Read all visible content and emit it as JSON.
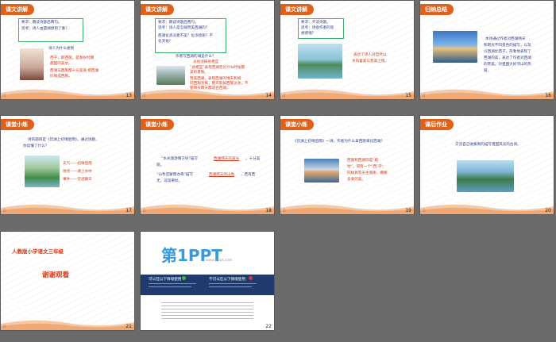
{
  "slides": [
    {
      "num": "13",
      "tag": "课文讲解",
      "lines": [
        "要求：朗读诗歌后两句。",
        "思考：诗人由西湖想到了谁？",
        "诗人为什么想到",
        "西子，即西施，是春秋时期",
        "越国的美女。",
        "西湖与西施都十分美丽 把西湖",
        "比喻成西施。"
      ]
    },
    {
      "num": "14",
      "tag": "课文讲解",
      "lines": [
        "要求：朗读诗歌后两句。",
        "思考：诗人是怎样赞美西湖的？",
        "西湖化浓淡素不美？化浓妆呢？不",
        "化浓妆？",
        "作者写西湖的湖是什么？",
        "淡妆浓抹总相宜",
        "“总相宜”表现西湖无论什么时候都",
        "美的景致。",
        "赞美西湖，表现西湖的晴天和如",
        "同西施浓抹，雨天就如西施淡妆，不",
        "管晴天雨天都适合西湖。"
      ]
    },
    {
      "num": "15",
      "tag": "课文讲解",
      "lines": [
        "要求：齐读诗歌。",
        "思考：诗会作者的思",
        "想感情？",
        "表达了诗人对自然山",
        "水的喜爱与赞美之情。"
      ]
    },
    {
      "num": "16",
      "tag": "归纳总结",
      "lines": [
        "本诗通过作者对西湖晴天",
        "和雨天不同景色的描写，以及",
        "以西湖比西子，形象地表现了",
        "西湖的美，表达了作者对西湖",
        "的赞美，对祖国大好河山的热",
        "爱。"
      ]
    },
    {
      "num": "17",
      "tag": "课堂小练",
      "lines": [
        "诗的题目是《饮湖上初晴后雨》，通过诗题，",
        "你读懂了什么？",
        "天气——初晴后雨",
        "地点——湖上水中",
        "事件——饮酒聊天"
      ]
    },
    {
      "num": "18",
      "tag": "课堂小练",
      "lines": [
        "“水光潋滟晴方好”描写",
        "西湖晴天的波光",
        "，十分美",
        "丽。",
        "“山色空蒙雨亦奇”描写",
        "西湖雨天的山色",
        "，若有若",
        "无，非常奇妙。"
      ]
    },
    {
      "num": "19",
      "tag": "课堂小练",
      "lines": [
        "《饮湖上初晴后雨》一诗，作者为什么拿西施来比西湖？",
        "西施和西湖同是“越",
        "地”，同有一个“西”字；",
        "同样具有天生丽质、婀娜",
        "多姿的美。"
      ]
    },
    {
      "num": "20",
      "tag": "课后作业",
      "lines": [
        "交流自己收集到的描写祖国风光的古诗。"
      ]
    },
    {
      "num": "21",
      "tag": "",
      "lines": [
        "人教版小学语文三年级",
        "谢谢观看"
      ]
    },
    {
      "num": "22",
      "tag": "",
      "lines": [
        "第1PPT",
        "www.1ppt.com",
        "可以在以下情境使用",
        "不可以在以下情境使用"
      ]
    }
  ],
  "star": "☆"
}
